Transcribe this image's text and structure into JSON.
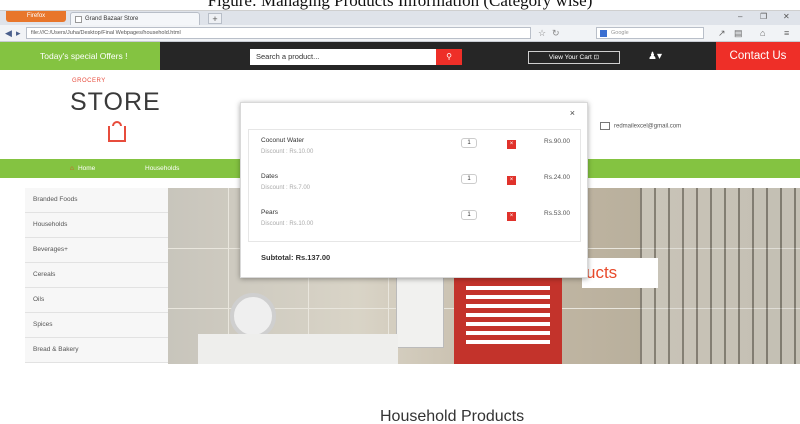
{
  "caption": "Figure: Managing Products Information (Category wise)",
  "browser": {
    "menu_button": "Firefox",
    "tab_title": "Grand Bazaar Store",
    "new_tab": "+",
    "url": "file:///C:/Users/Juha/Desktop/Final Webpages/household.html",
    "search_placeholder": "Google",
    "window_controls": [
      "–",
      "❐",
      "✕"
    ]
  },
  "header": {
    "offers": "Today's special Offers !",
    "search_placeholder": "Search a product...",
    "cart_button": "View Your Cart",
    "contact": "Contact Us"
  },
  "logo": {
    "small": "GROCERY",
    "main": "STORE"
  },
  "contact_email": "redmailexcel@gmail.com",
  "nav": {
    "home": "Home",
    "household": "Households"
  },
  "sidebar": {
    "items": [
      {
        "label": "Branded Foods"
      },
      {
        "label": "Households"
      },
      {
        "label": "Beverages+"
      },
      {
        "label": "Cereals"
      },
      {
        "label": "Oils"
      },
      {
        "label": "Spices"
      },
      {
        "label": "Bread & Bakery"
      }
    ]
  },
  "banner": {
    "label": "ucts"
  },
  "cart": {
    "items": [
      {
        "name": "Coconut Water",
        "discount": "Discount : Rs.10.00",
        "qty": "1",
        "price": "Rs.90.00"
      },
      {
        "name": "Dates",
        "discount": "Discount : Rs.7.00",
        "qty": "1",
        "price": "Rs.24.00"
      },
      {
        "name": "Pears",
        "discount": "Discount : Rs.10.00",
        "qty": "1",
        "price": "Rs.53.00"
      }
    ],
    "subtotal": "Subtotal: Rs.137.00",
    "close": "×"
  },
  "products_heading": "Household Products",
  "colors": {
    "green": "#84c341",
    "red": "#ee2f28",
    "dark": "#262626"
  }
}
